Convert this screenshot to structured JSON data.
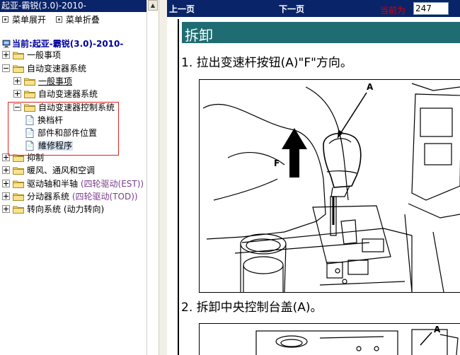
{
  "left": {
    "title": "起亚-霸锐(3.0)-2010-",
    "menu_expand": "菜单展开",
    "menu_collapse": "菜单折叠",
    "current_label": "当前:起亚-霸锐(3.0)-2010-",
    "tree": [
      {
        "label": "一般事项",
        "state": "plus"
      },
      {
        "label": "自动变速器系统",
        "state": "minus"
      },
      {
        "label": "一般事项",
        "state": "plus",
        "link": true
      },
      {
        "label": "自动变速器系统",
        "state": "plus"
      },
      {
        "label": "自动变速器控制系统",
        "state": "minus"
      },
      {
        "label": "换档杆"
      },
      {
        "label": "部件和部件位置"
      },
      {
        "label": "維修程序",
        "selected": true
      },
      {
        "label": "抑制",
        "state": "plus"
      },
      {
        "label": "暖风、通风和空调",
        "state": "plus"
      },
      {
        "label": "驱动轴和半轴 ",
        "en": "(四轮驱动(EST))",
        "state": "plus"
      },
      {
        "label": "分动器系统 ",
        "en": "(四轮驱动(TOD))",
        "state": "plus"
      },
      {
        "label": "转向系统 (动力转向)",
        "state": "plus"
      }
    ]
  },
  "nav": {
    "prev": "上一页",
    "next": "下一页",
    "current_label": "当前为",
    "current_page": "247"
  },
  "content": {
    "title": "拆卸",
    "step1": "1. 拉出变速杆按钮(A)\"F\"方向。",
    "step2": "2. 拆卸中央控制台盖(A)。",
    "fig1_label_a": "A",
    "fig1_label_f": "F",
    "fig2_label_a": "A"
  },
  "colors": {
    "title_bar": "#0a246a",
    "header_bar": "#1f6d72",
    "current_page_label": "#e00000",
    "current_node": "#00009c",
    "highlight_box": "#d22222"
  }
}
